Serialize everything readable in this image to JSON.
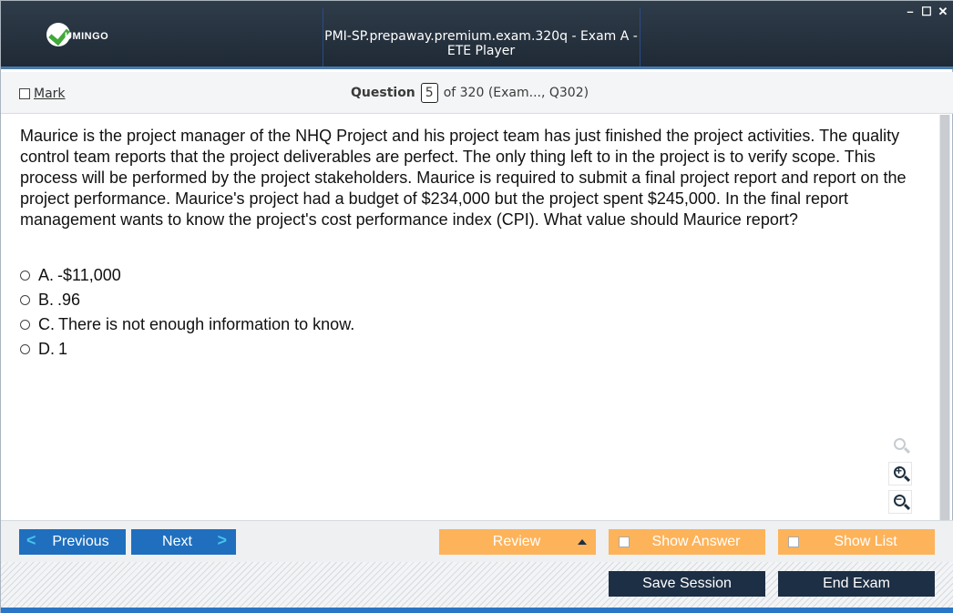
{
  "window": {
    "logo_text": "UMINGO",
    "title": "PMI-SP.prepaway.premium.exam.320q - Exam A - ETE Player",
    "controls": {
      "minimize": "–",
      "maximize": "☐",
      "close": "✕"
    }
  },
  "header": {
    "mark_label": "Mark",
    "question_label": "Question",
    "question_number": "5",
    "question_of": "of 320 (Exam..., Q302)"
  },
  "question": {
    "text": "Maurice is the project manager of the NHQ Project and his project team has just finished the project activities. The quality control team reports that the project deliverables are perfect. The only thing left to in the project is to verify scope. This process will be performed by the project stakeholders. Maurice is required to submit a final project report and report on the project performance. Maurice's project had a budget of $234,000 but the project spent $245,000. In the final report management wants to know the project's cost performance index (CPI). What value should Maurice report?",
    "options": [
      {
        "letter": "A.",
        "text": "-$11,000"
      },
      {
        "letter": "B.",
        "text": ".96"
      },
      {
        "letter": "C.",
        "text": "There is not enough information to know."
      },
      {
        "letter": "D.",
        "text": "1"
      }
    ]
  },
  "zoom": {
    "zoom_in_symbol": "+",
    "zoom_out_symbol": "−"
  },
  "toolbar": {
    "previous_label": "Previous",
    "next_label": "Next",
    "review_label": "Review",
    "show_answer_label": "Show Answer",
    "show_list_label": "Show List",
    "save_session_label": "Save Session",
    "end_exam_label": "End Exam",
    "prev_chevron": "<",
    "next_chevron": ">"
  }
}
